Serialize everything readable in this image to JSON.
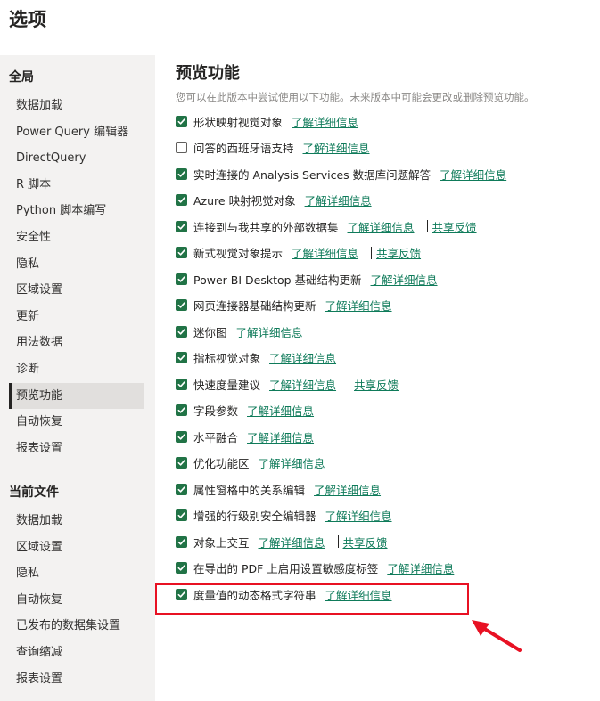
{
  "window": {
    "title": "选项"
  },
  "sidebar": {
    "global_title": "全局",
    "global_items": [
      "数据加载",
      "Power Query 编辑器",
      "DirectQuery",
      "R 脚本",
      "Python 脚本编写",
      "安全性",
      "隐私",
      "区域设置",
      "更新",
      "用法数据",
      "诊断",
      "预览功能",
      "自动恢复",
      "报表设置"
    ],
    "selected_item": "预览功能",
    "current_title": "当前文件",
    "current_items": [
      "数据加载",
      "区域设置",
      "隐私",
      "自动恢复",
      "已发布的数据集设置",
      "查询缩减",
      "报表设置"
    ]
  },
  "main": {
    "title": "预览功能",
    "description": "您可以在此版本中尝试使用以下功能。未来版本中可能会更改或删除预览功能。",
    "features": [
      {
        "label": "形状映射视觉对象",
        "checked": true,
        "link": "了解详细信息"
      },
      {
        "label": "问答的西班牙语支持",
        "checked": false,
        "link": "了解详细信息"
      },
      {
        "label": "实时连接的 Analysis Services 数据库问题解答",
        "checked": true,
        "link": "了解详细信息"
      },
      {
        "label": "Azure 映射视觉对象",
        "checked": true,
        "link": "了解详细信息"
      },
      {
        "label": "连接到与我共享的外部数据集",
        "checked": true,
        "link": "了解详细信息",
        "feedback": "共享反馈"
      },
      {
        "label": "新式视觉对象提示",
        "checked": true,
        "link": "了解详细信息",
        "feedback": "共享反馈"
      },
      {
        "label": "Power BI Desktop 基础结构更新",
        "checked": true,
        "link": "了解详细信息"
      },
      {
        "label": "网页连接器基础结构更新",
        "checked": true,
        "link": "了解详细信息"
      },
      {
        "label": "迷你图",
        "checked": true,
        "link": "了解详细信息"
      },
      {
        "label": "指标视觉对象",
        "checked": true,
        "link": "了解详细信息"
      },
      {
        "label": "快速度量建议",
        "checked": true,
        "link": "了解详细信息",
        "feedback": "共享反馈"
      },
      {
        "label": "字段参数",
        "checked": true,
        "link": "了解详细信息"
      },
      {
        "label": "水平融合",
        "checked": true,
        "link": "了解详细信息"
      },
      {
        "label": "优化功能区",
        "checked": true,
        "link": "了解详细信息"
      },
      {
        "label": "属性窗格中的关系编辑",
        "checked": true,
        "link": "了解详细信息"
      },
      {
        "label": "增强的行级别安全编辑器",
        "checked": true,
        "link": "了解详细信息"
      },
      {
        "label": "对象上交互",
        "checked": true,
        "link": "了解详细信息",
        "feedback": "共享反馈"
      },
      {
        "label": "在导出的 PDF 上启用设置敏感度标签",
        "checked": true,
        "link": "了解详细信息"
      },
      {
        "label": "度量值的动态格式字符串",
        "checked": true,
        "link": "了解详细信息"
      }
    ]
  },
  "annotation": {
    "highlight_color": "#e81123",
    "highlighted_feature": "度量值的动态格式字符串"
  },
  "colors": {
    "checkbox_checked": "#217346",
    "link": "#0f7b5a",
    "sidebar_bg": "#f3f2f1",
    "selected_bg": "#e1dfdd"
  }
}
